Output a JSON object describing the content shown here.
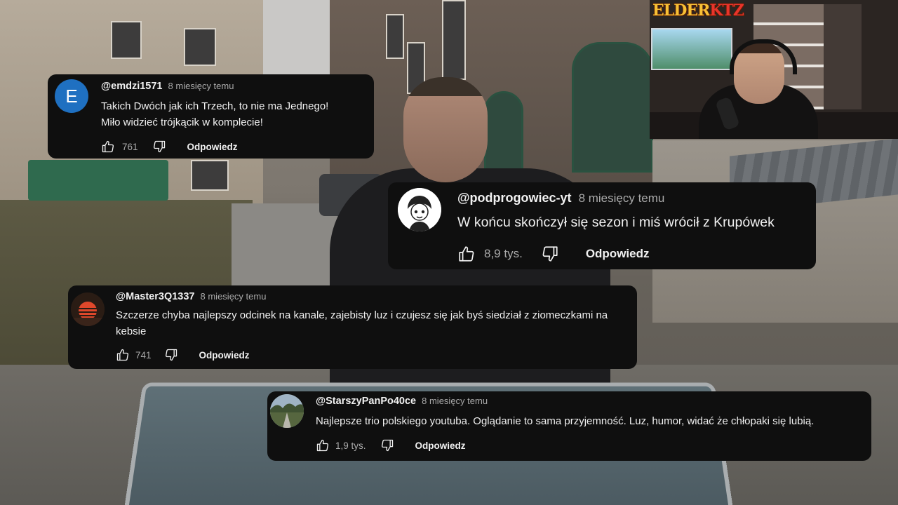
{
  "webcam": {
    "logo_part1": "ELDER",
    "logo_part2": "KTZ"
  },
  "comments": [
    {
      "avatar_letter": "E",
      "avatar_color": "#1f70c1",
      "handle": "@emdzi1571",
      "time": "8 miesięcy temu",
      "text_lines": [
        "Takich Dwóch jak ich Trzech, to nie ma Jednego!",
        "Miło widzieć trójkącik w komplecie!"
      ],
      "likes": "761",
      "reply_label": "Odpowiedz"
    },
    {
      "avatar_letter": "",
      "handle": "@podprogowiec-yt",
      "time": "8 miesięcy temu",
      "text": "W końcu skończył się sezon i miś wrócił z Krupówek",
      "likes": "8,9 tys.",
      "reply_label": "Odpowiedz"
    },
    {
      "avatar_letter": "",
      "handle": "@Master3Q1337",
      "time": "8 miesięcy temu",
      "text": "Szczerze chyba najlepszy odcinek na kanale, zajebisty luz i czujesz się jak byś siedział z ziomeczkami na kebsie",
      "likes": "741",
      "reply_label": "Odpowiedz"
    },
    {
      "avatar_letter": "",
      "handle": "@StarszyPanPo40ce",
      "time": "8 miesięcy temu",
      "text": "Najlepsze trio polskiego youtuba. Oglądanie to sama przyjemność. Luz, humor, widać że chłopaki się lubią.",
      "likes": "1,9 tys.",
      "reply_label": "Odpowiedz"
    }
  ],
  "colors": {
    "card_bg": "#0f0f0f",
    "text_primary": "#f1f1f1",
    "text_secondary": "#aaaaaa"
  }
}
